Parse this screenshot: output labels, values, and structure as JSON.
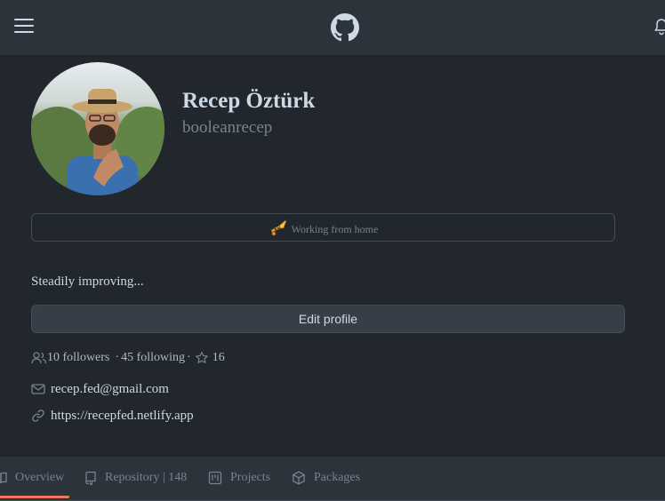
{
  "profile": {
    "full_name": "Recep Öztürk",
    "username": "booleanrecep",
    "status": "Working from home",
    "bio": "Steadily improving...",
    "edit_label": "Edit profile",
    "followers": "10 followers",
    "following": "45 following",
    "stars": "16",
    "email": "recep.fed@gmail.com",
    "website": "https://recepfed.netlify.app"
  },
  "tabs": [
    {
      "label": "Overview",
      "icon": "book-icon"
    },
    {
      "label": "Repository | 148",
      "icon": "repo-icon"
    },
    {
      "label": "Projects",
      "icon": "project-icon"
    },
    {
      "label": "Packages",
      "icon": "package-icon"
    }
  ],
  "colors": {
    "background": "#22272e",
    "header": "#2d333b",
    "accent": "#ec775c",
    "text": "#cdd9e5",
    "muted": "#768390"
  }
}
